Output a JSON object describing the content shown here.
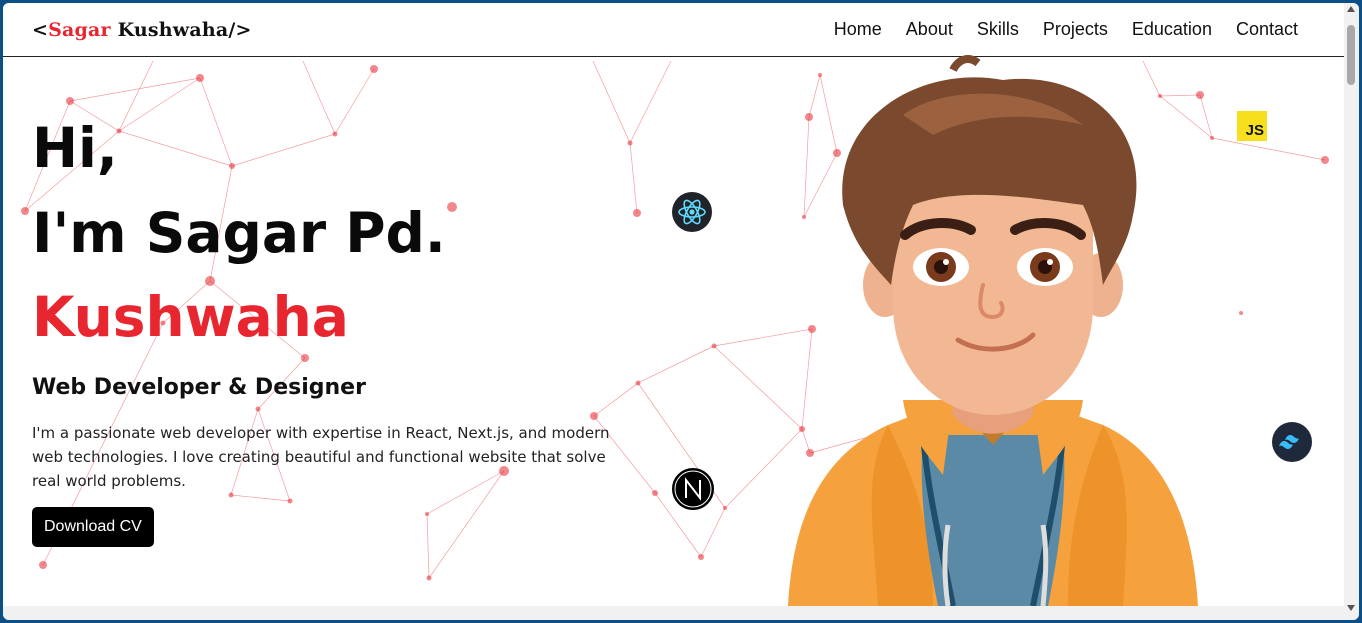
{
  "logo": {
    "open": "<",
    "first": "Sagar",
    "rest": " Kushwaha/>"
  },
  "nav": [
    "Home",
    "About",
    "Skills",
    "Projects",
    "Education",
    "Contact"
  ],
  "hero": {
    "line1": "Hi,",
    "line2": "I'm Sagar Pd.",
    "line3": "Kushwaha",
    "subtitle": "Web Developer & Designer",
    "description": "I'm a passionate web developer with expertise in React, Next.js, and modern web technologies. I love creating beautiful and functional website that solve real world problems.",
    "button": "Download CV"
  },
  "badges": {
    "js": "JS"
  },
  "colors": {
    "accent": "#e8262f",
    "network": "#e8262f",
    "button": "#000000"
  },
  "icons": [
    "react-icon",
    "nextjs-icon",
    "tailwind-icon",
    "javascript-icon"
  ]
}
